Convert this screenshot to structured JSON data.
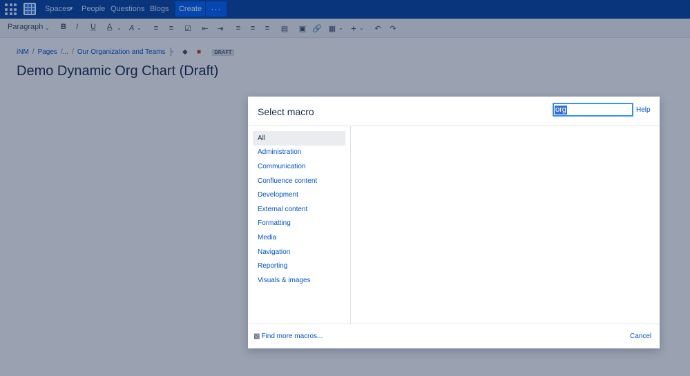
{
  "nav": {
    "spaces": "Spaces",
    "people": "People",
    "questions": "Questions",
    "blogs": "Blogs",
    "create": "Create",
    "more": "···"
  },
  "toolbar": {
    "paragraph": "Paragraph",
    "bold": "B",
    "italic": "I",
    "underline": "U",
    "text_color": "A"
  },
  "breadcrumb": {
    "space": "iNM",
    "pages": "Pages",
    "ellipsis": "...",
    "parent": "Our Organization and Teams",
    "badge": "DRAFT"
  },
  "page": {
    "title": "Demo Dynamic Org Chart (Draft)"
  },
  "dialog": {
    "title": "Select macro",
    "search_value": "org",
    "help": "Help",
    "categories": [
      "All",
      "Administration",
      "Communication",
      "Confluence content",
      "Development",
      "External content",
      "Formatting",
      "Media",
      "Navigation",
      "Reporting",
      "Visuals & images"
    ],
    "selected_category": "All",
    "find_more": "Find more macros...",
    "cancel": "Cancel"
  },
  "colors": {
    "nav_bg": "#0747a6",
    "create_bg": "#0065ff",
    "link": "#0052cc",
    "overlay": "rgba(9,30,66,0.41)"
  }
}
